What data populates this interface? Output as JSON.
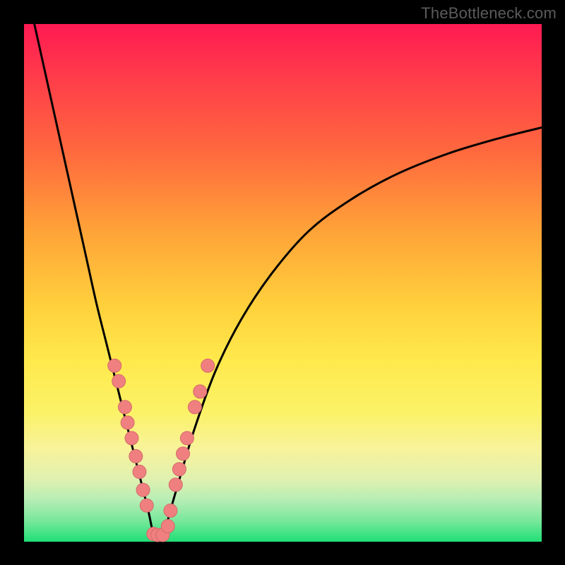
{
  "watermark": "TheBottleneck.com",
  "colors": {
    "gradient_top": "#ff1a52",
    "gradient_bottom": "#1fdf77",
    "curve": "#000000",
    "dot_fill": "#f08080",
    "dot_stroke": "#d46a6a",
    "background": "#000000"
  },
  "chart_data": {
    "type": "line",
    "title": "",
    "xlabel": "",
    "ylabel": "",
    "xlim": [
      0,
      100
    ],
    "ylim": [
      0,
      100
    ],
    "series": [
      {
        "name": "left-curve",
        "x": [
          2,
          4,
          6,
          8,
          10,
          12,
          14,
          16,
          18,
          20,
          22,
          24,
          25
        ],
        "y": [
          100,
          91,
          82,
          73,
          64,
          55,
          46,
          38,
          30,
          22,
          14,
          6,
          1
        ]
      },
      {
        "name": "right-curve",
        "x": [
          27,
          28,
          30,
          33,
          37,
          42,
          48,
          55,
          63,
          72,
          82,
          92,
          100
        ],
        "y": [
          1,
          5,
          12,
          22,
          33,
          43,
          52,
          60,
          66,
          71,
          75,
          78,
          80
        ]
      }
    ],
    "scatter": [
      {
        "x": 17.5,
        "y": 34
      },
      {
        "x": 18.3,
        "y": 31
      },
      {
        "x": 19.5,
        "y": 26
      },
      {
        "x": 20.0,
        "y": 23
      },
      {
        "x": 20.8,
        "y": 20
      },
      {
        "x": 21.6,
        "y": 16.5
      },
      {
        "x": 22.3,
        "y": 13.5
      },
      {
        "x": 23.0,
        "y": 10
      },
      {
        "x": 23.7,
        "y": 7
      },
      {
        "x": 25.0,
        "y": 1.5
      },
      {
        "x": 25.8,
        "y": 1.3
      },
      {
        "x": 26.8,
        "y": 1.3
      },
      {
        "x": 27.8,
        "y": 3
      },
      {
        "x": 28.3,
        "y": 6
      },
      {
        "x": 29.3,
        "y": 11
      },
      {
        "x": 30.0,
        "y": 14
      },
      {
        "x": 30.7,
        "y": 17
      },
      {
        "x": 31.5,
        "y": 20
      },
      {
        "x": 33.0,
        "y": 26
      },
      {
        "x": 34.0,
        "y": 29
      },
      {
        "x": 35.5,
        "y": 34
      }
    ]
  }
}
